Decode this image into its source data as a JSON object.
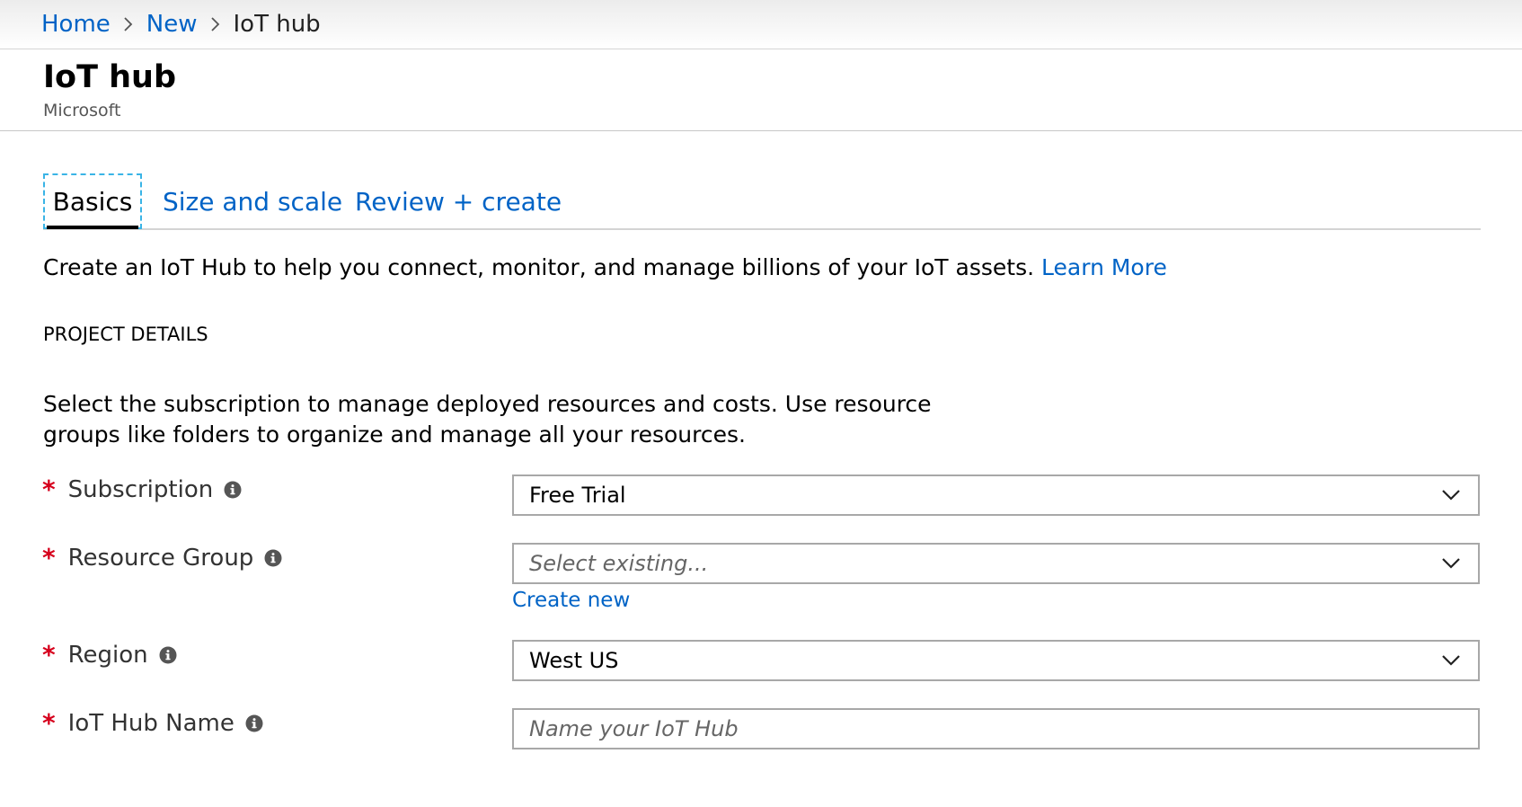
{
  "breadcrumb": {
    "items": [
      {
        "label": "Home"
      },
      {
        "label": "New"
      },
      {
        "label": "IoT hub"
      }
    ]
  },
  "header": {
    "title": "IoT hub",
    "subtitle": "Microsoft"
  },
  "tabs": [
    {
      "label": "Basics",
      "active": true
    },
    {
      "label": "Size and scale",
      "active": false
    },
    {
      "label": "Review + create",
      "active": false
    }
  ],
  "intro": {
    "text": "Create an IoT Hub to help you connect, monitor, and manage billions of your IoT assets.",
    "link": "Learn More"
  },
  "project_details": {
    "heading": "PROJECT DETAILS",
    "description": "Select the subscription to manage deployed resources and costs. Use resource groups like folders to organize and manage all your resources."
  },
  "form": {
    "required_marker": "*",
    "subscription": {
      "label": "Subscription",
      "value": "Free Trial"
    },
    "resource_group": {
      "label": "Resource Group",
      "placeholder": "Select existing...",
      "create_new": "Create new"
    },
    "region": {
      "label": "Region",
      "value": "West US"
    },
    "hub_name": {
      "label": "IoT Hub Name",
      "placeholder": "Name your IoT Hub"
    }
  },
  "icons": {
    "breadcrumb_separator": "chevron-right-icon",
    "dropdown": "chevron-down-icon",
    "info": "info-icon"
  },
  "colors": {
    "link": "#0063c6",
    "required": "#d6001c",
    "active_tab_focus": "#3ab4e6"
  }
}
